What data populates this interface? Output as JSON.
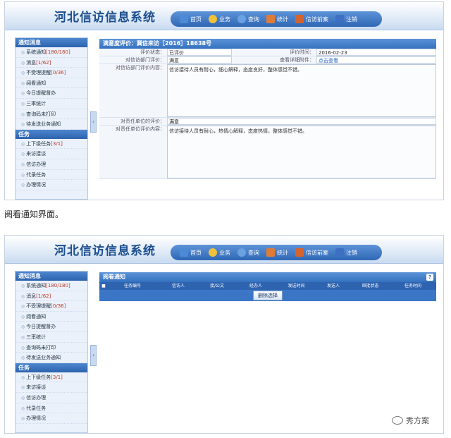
{
  "app_title": "河北信访信息系统",
  "nav": [
    "首页",
    "业务",
    "查询",
    "统计",
    "信访前案",
    "注销"
  ],
  "sidebar": {
    "section1": "通知消息",
    "items1": [
      {
        "label": "系统通知",
        "count": "[180/180]"
      },
      {
        "label": "消息",
        "count": "[1/62]"
      },
      {
        "label": "不受理提醒",
        "count": "[0/36]"
      },
      {
        "label": "阅看通知",
        "count": ""
      },
      {
        "label": "今日提醒督办",
        "count": ""
      },
      {
        "label": "三率统计",
        "count": ""
      },
      {
        "label": "查询码未打印",
        "count": ""
      },
      {
        "label": "待发送业务通知",
        "count": ""
      }
    ],
    "section2": "任务",
    "items2": [
      {
        "label": "上下级任务",
        "count": "[3/1]"
      },
      {
        "label": "来访接谈",
        "count": ""
      },
      {
        "label": "信访办理",
        "count": ""
      },
      {
        "label": "代录任务",
        "count": ""
      },
      {
        "label": "办理情况",
        "count": ""
      }
    ]
  },
  "detail": {
    "title": "满意度评价：冀信来访［2016］18638号",
    "rows": {
      "status_label": "评价状态：",
      "status_value": "已评价",
      "time_label": "评价时间：",
      "time_value": "2016-02-23",
      "dept_label": "对信访部门评价：",
      "dept_value": "满意",
      "attach_label": "查看详细附件：",
      "attach_value": "点击查看",
      "dept_content_label": "对信访部门评价内容：",
      "dept_content_value": "信访接待人员有耐心，细心解释，态度良好，整体感觉不错。",
      "unit_label": "对责任单位的评价：",
      "unit_value": "满意",
      "unit_content_label": "对责任单位评价内容：",
      "unit_content_value": "信访接待人员有耐心，热情心解释，态度热情，整体感觉不错。"
    }
  },
  "caption": "阅看通知界面。",
  "notice": {
    "title": "阅看通知",
    "help": "?",
    "columns": [
      "任务编号",
      "信访人",
      "接/公文",
      "经办人",
      "发送时间",
      "发送人",
      "审批状态",
      "任务时间"
    ],
    "button": "删除选择"
  },
  "watermark": "秀方案"
}
